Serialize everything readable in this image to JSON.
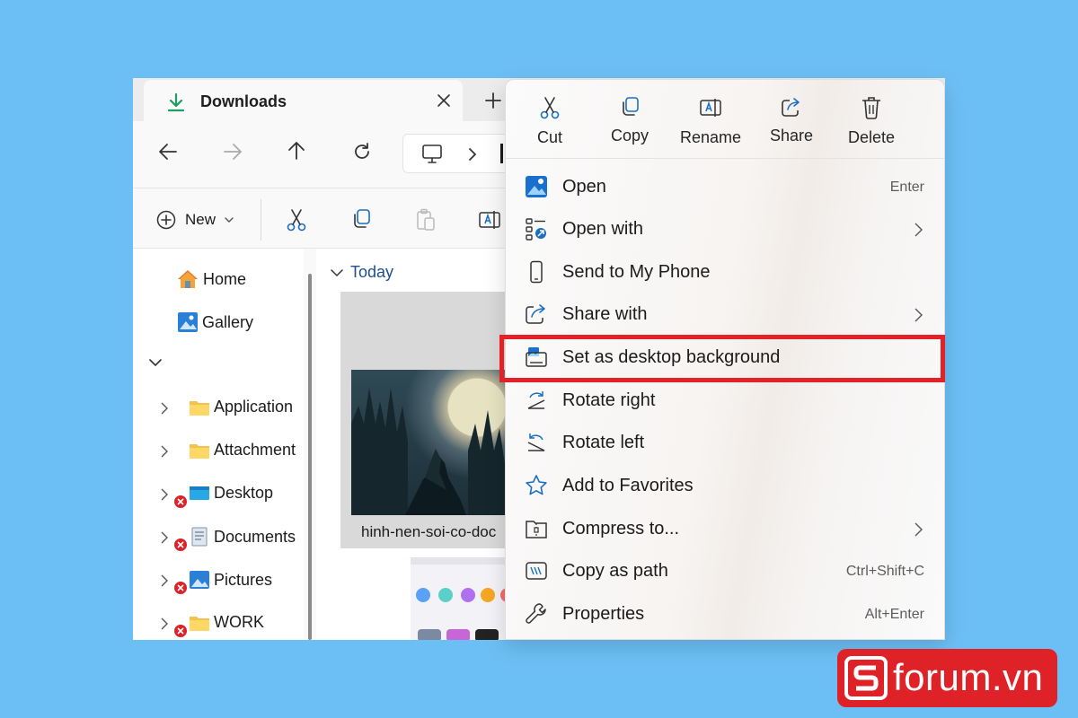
{
  "colors": {
    "background": "#6cbff5",
    "accent": "#0f6cbd",
    "highlight_frame": "#e32127",
    "error_badge": "#d9242a",
    "logo": "#df2227"
  },
  "tab": {
    "title": "Downloads",
    "icon": "download-icon"
  },
  "navigation": {
    "back": "arrow-left-icon",
    "forward": "arrow-right-icon",
    "up": "arrow-up-icon",
    "refresh": "refresh-icon"
  },
  "toolbar": {
    "new_label": "New"
  },
  "sidebar": {
    "home": "Home",
    "gallery": "Gallery",
    "folders": [
      {
        "label": "Application",
        "error": false,
        "icon": "folder-icon"
      },
      {
        "label": "Attachment",
        "error": false,
        "icon": "folder-icon"
      },
      {
        "label": "Desktop",
        "error": true,
        "icon": "desktop-folder-icon"
      },
      {
        "label": "Documents",
        "error": true,
        "icon": "documents-folder-icon"
      },
      {
        "label": "Pictures",
        "error": true,
        "icon": "pictures-folder-icon"
      },
      {
        "label": "WORK",
        "error": true,
        "icon": "folder-icon"
      }
    ]
  },
  "content": {
    "group_label": "Today",
    "files": [
      {
        "name": "hinh-nen-soi-co-doc"
      }
    ]
  },
  "context_menu": {
    "actions": [
      {
        "label": "Cut",
        "icon": "scissors-icon"
      },
      {
        "label": "Copy",
        "icon": "copy-icon"
      },
      {
        "label": "Rename",
        "icon": "rename-icon"
      },
      {
        "label": "Share",
        "icon": "share-icon"
      },
      {
        "label": "Delete",
        "icon": "trash-icon"
      }
    ],
    "items": [
      {
        "label": "Open",
        "shortcut": "Enter",
        "icon": "photos-app-icon"
      },
      {
        "label": "Open with",
        "submenu": true,
        "icon": "open-with-icon"
      },
      {
        "label": "Send to My Phone",
        "icon": "phone-icon"
      },
      {
        "label": "Share with",
        "submenu": true,
        "icon": "share-icon"
      },
      {
        "label": "Set as desktop background",
        "highlighted": true,
        "icon": "desktop-background-icon"
      },
      {
        "label": "Rotate right",
        "icon": "rotate-right-icon"
      },
      {
        "label": "Rotate left",
        "icon": "rotate-left-icon"
      },
      {
        "label": "Add to Favorites",
        "icon": "star-icon"
      },
      {
        "label": "Compress to...",
        "submenu": true,
        "icon": "zip-icon"
      },
      {
        "label": "Copy as path",
        "shortcut": "Ctrl+Shift+C",
        "icon": "copy-path-icon"
      },
      {
        "label": "Properties",
        "shortcut": "Alt+Enter",
        "icon": "wrench-icon"
      }
    ]
  },
  "watermark": {
    "brand": "forum.vn"
  }
}
